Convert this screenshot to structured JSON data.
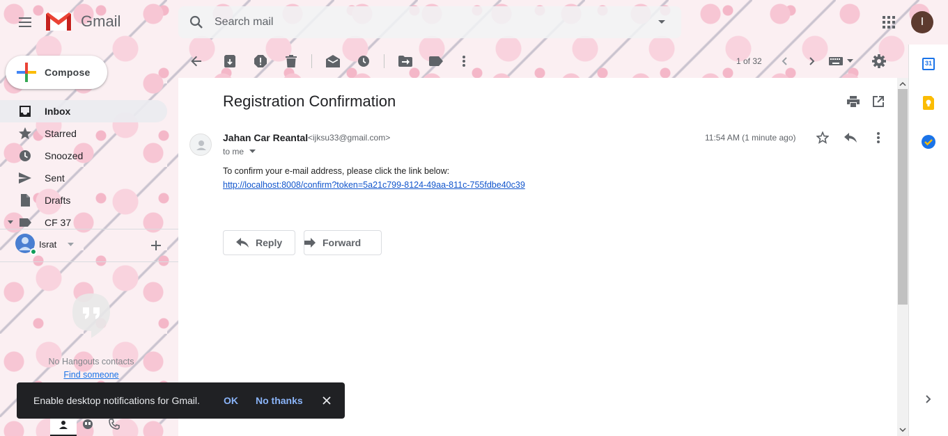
{
  "app": {
    "name": "Gmail"
  },
  "header": {
    "search_placeholder": "Search mail",
    "avatar_initial": "I"
  },
  "sidebar": {
    "compose_label": "Compose",
    "items": [
      {
        "label": "Inbox",
        "icon": "inbox-icon",
        "active": true
      },
      {
        "label": "Starred",
        "icon": "star-icon"
      },
      {
        "label": "Snoozed",
        "icon": "clock-icon"
      },
      {
        "label": "Sent",
        "icon": "send-icon"
      },
      {
        "label": "Drafts",
        "icon": "draft-icon"
      },
      {
        "label": "CF 37",
        "icon": "label-icon"
      }
    ],
    "hangouts_user": "Israt",
    "hangouts_empty": "No Hangouts contacts",
    "find_someone": "Find someone"
  },
  "toolbar": {
    "pagination": "1 of 32"
  },
  "email": {
    "subject": "Registration Confirmation",
    "sender_name": "Jahan Car Reantal",
    "sender_email": "<ijksu33@gmail.com>",
    "recipient": "to me",
    "timestamp": "11:54 AM (1 minute ago)",
    "body_text": "To confirm your e-mail address, please click the link below:",
    "body_link": "http://localhost:8008/confirm?token=5a21c799-8124-49aa-811c-755fdbe40c39",
    "reply_label": "Reply",
    "forward_label": "Forward"
  },
  "right_panel": {
    "calendar_day": "31"
  },
  "toast": {
    "text": "Enable desktop notifications for Gmail.",
    "ok_label": "OK",
    "no_thanks_label": "No thanks"
  },
  "colors": {
    "gmail_red": "#ea4335",
    "link_blue": "#1155cc",
    "toast_bg": "#202124",
    "toast_action": "#8ab4f8",
    "avatar_bg": "#5d3a2f"
  }
}
